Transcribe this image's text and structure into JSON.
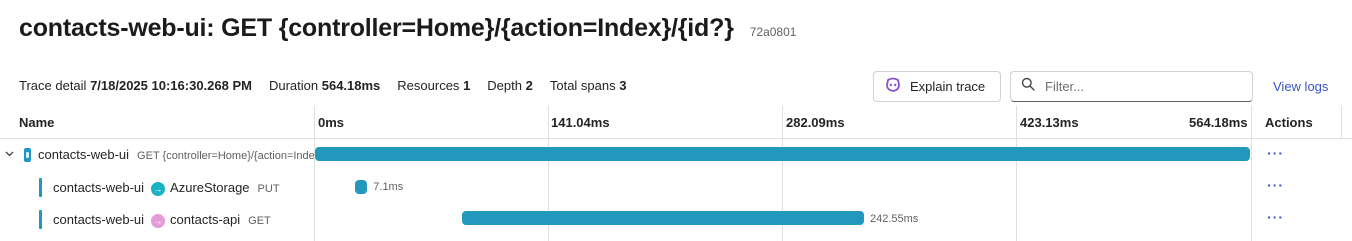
{
  "header": {
    "title": "contacts-web-ui: GET {controller=Home}/{action=Index}/{id?}",
    "trace_id": "72a0801"
  },
  "info": {
    "trace_detail_label": "Trace detail",
    "trace_detail_value": "7/18/2025 10:16:30.268 PM",
    "duration_label": "Duration",
    "duration_value": "564.18ms",
    "resources_label": "Resources",
    "resources_value": "1",
    "depth_label": "Depth",
    "depth_value": "2",
    "total_spans_label": "Total spans",
    "total_spans_value": "3"
  },
  "toolbar": {
    "explain_label": "Explain trace",
    "filter_placeholder": "Filter...",
    "view_logs_label": "View logs"
  },
  "columns": {
    "name": "Name",
    "actions": "Actions",
    "ticks": [
      "0ms",
      "141.04ms",
      "282.09ms",
      "423.13ms",
      "564.18ms"
    ]
  },
  "timeline": {
    "total_ms": 564.18
  },
  "spans": [
    {
      "service": "contacts-web-ui",
      "peer": "",
      "detail": "GET {controller=Home}/{action=Index}/{id?}",
      "start_ms": 0,
      "duration_ms": 564.18,
      "label": "",
      "actions": "···"
    },
    {
      "service": "contacts-web-ui",
      "peer": "AzureStorage",
      "detail": "PUT",
      "start_ms": 24.3,
      "duration_ms": 7.1,
      "label": "7.1ms",
      "actions": "···"
    },
    {
      "service": "contacts-web-ui",
      "peer": "contacts-api",
      "detail": "GET",
      "start_ms": 88.7,
      "duration_ms": 242.55,
      "label": "242.55ms",
      "actions": "···"
    }
  ],
  "colors": {
    "bar": "#2497bd",
    "link": "#3b53c8",
    "azure_peer": "#1ab3c3",
    "api_peer": "#e59bd9"
  }
}
